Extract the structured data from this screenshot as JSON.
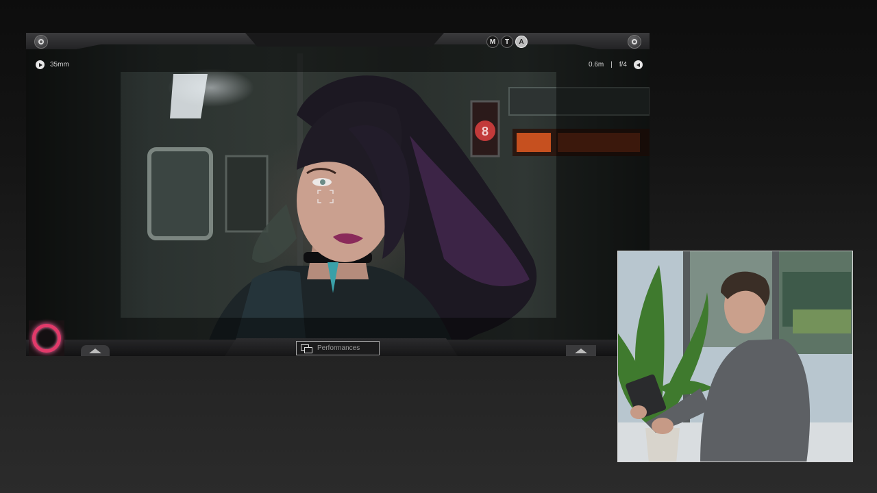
{
  "vcam": {
    "lens": "35mm",
    "focus_distance": "0.6m",
    "separator": "|",
    "aperture": "f/4",
    "modes": [
      {
        "label": "M",
        "active": false
      },
      {
        "label": "T",
        "active": false
      },
      {
        "label": "A",
        "active": true
      }
    ],
    "performances_label": "Performances",
    "record_color": "#e23a6a"
  },
  "icons": [
    "eye-icon",
    "settings-icon",
    "play-icon",
    "back-icon",
    "record-icon",
    "up-arrow-icon",
    "performances-icon",
    "focus-reticle-icon"
  ]
}
